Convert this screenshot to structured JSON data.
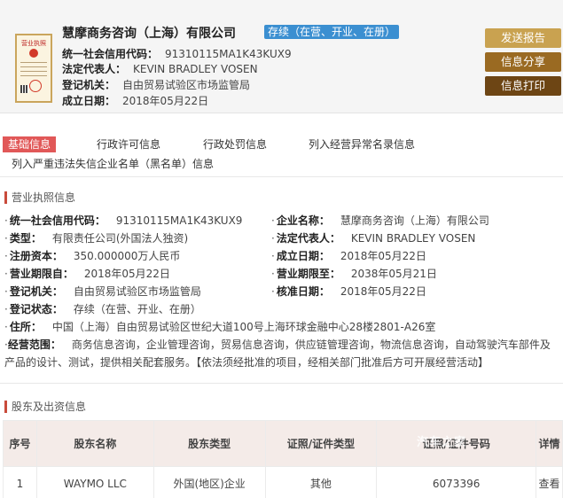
{
  "header": {
    "company_name": "慧摩商务咨询（上海）有限公司",
    "status": "存续（在营、开业、在册）",
    "credit_code_label": "统一社会信用代码：",
    "credit_code": "91310115MA1K43KUX9",
    "legal_rep_label": "法定代表人：",
    "legal_rep": "KEVIN BRADLEY VOSEN",
    "authority_label": "登记机关：",
    "authority": "自由贸易试验区市场监管局",
    "established_label": "成立日期：",
    "established": "2018年05月22日",
    "thumb_text": "营业执照"
  },
  "buttons": {
    "send_report": "发送报告",
    "share": "信息分享",
    "print": "信息打印"
  },
  "tabs": [
    "基础信息",
    "行政许可信息",
    "行政处罚信息",
    "列入经营异常名录信息",
    "列入严重违法失信企业名单（黑名单）信息"
  ],
  "license_section": {
    "title": "营业执照信息",
    "rows": [
      {
        "k": "统一社会信用代码：",
        "v": "91310115MA1K43KUX9"
      },
      {
        "k": "企业名称：",
        "v": "慧摩商务咨询（上海）有限公司"
      },
      {
        "k": "类型：",
        "v": "有限责任公司(外国法人独资)"
      },
      {
        "k": "法定代表人：",
        "v": "KEVIN BRADLEY VOSEN"
      },
      {
        "k": "注册资本：",
        "v": "350.000000万人民币"
      },
      {
        "k": "成立日期：",
        "v": "2018年05月22日"
      },
      {
        "k": "营业期限自：",
        "v": "2018年05月22日"
      },
      {
        "k": "营业期限至：",
        "v": "2038年05月21日"
      },
      {
        "k": "登记机关：",
        "v": "自由贸易试验区市场监管局"
      },
      {
        "k": "核准日期：",
        "v": "2018年05月22日"
      },
      {
        "k": "登记状态：",
        "v": "存续（在营、开业、在册）"
      },
      {
        "k": "住所：",
        "v": "中国（上海）自由贸易试验区世纪大道100号上海环球金融中心28楼2801-A26室"
      }
    ],
    "scope_label": "经营范围：",
    "scope": "商务信息咨询，企业管理咨询，贸易信息咨询，供应链管理咨询，物流信息咨询，自动驾驶汽车部件及产品的设计、测试，提供相关配套服务。【依法须经批准的项目，经相关部门批准后方可开展经营活动】"
  },
  "shareholder_section": {
    "title": "股东及出资信息",
    "headers": [
      "序号",
      "股东名称",
      "股东类型",
      "证照/证件类型",
      "证照/证件号码",
      "详情"
    ],
    "rows": [
      {
        "no": "1",
        "name": "WAYMO LLC",
        "type": "外国(地区)企业",
        "id_type": "其他",
        "id_no": "6073396",
        "detail": "查看"
      }
    ],
    "watermark": "汽车之家"
  }
}
